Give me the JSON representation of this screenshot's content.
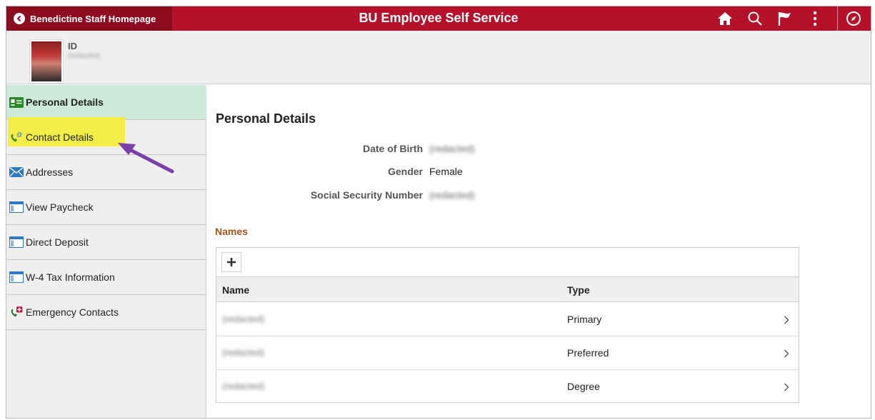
{
  "header": {
    "back_label": "Benedictine Staff Homepage",
    "title": "BU Employee Self Service",
    "icons": [
      "home-icon",
      "search-icon",
      "flag-icon",
      "more-options-icon",
      "navbar-compass-icon"
    ],
    "colors": {
      "header_bg": "#b5112a",
      "back_bg": "#8e0c20"
    }
  },
  "profile": {
    "id_label": "ID",
    "id_value": "(redacted)"
  },
  "sidebar": {
    "items": [
      {
        "label": "Personal Details",
        "icon": "id-card-icon",
        "active": true
      },
      {
        "label": "Contact Details",
        "icon": "phone-at-icon",
        "highlighted": true
      },
      {
        "label": "Addresses",
        "icon": "envelope-icon"
      },
      {
        "label": "View Paycheck",
        "icon": "document-window-icon"
      },
      {
        "label": "Direct Deposit",
        "icon": "document-window-icon"
      },
      {
        "label": "W-4 Tax Information",
        "icon": "document-window-icon"
      },
      {
        "label": "Emergency Contacts",
        "icon": "phone-cross-icon"
      }
    ],
    "colors": {
      "active_bg": "#cde9d9",
      "highlight": "#f2ee45",
      "arrow": "#7a3fa8"
    }
  },
  "main": {
    "title": "Personal Details",
    "fields": [
      {
        "label": "Date of Birth",
        "value": "(redacted)",
        "blurred": true
      },
      {
        "label": "Gender",
        "value": "Female",
        "blurred": false
      },
      {
        "label": "Social Security Number",
        "value": "(redacted)",
        "blurred": true
      }
    ],
    "names": {
      "title": "Names",
      "add_icon": "plus-icon",
      "columns": [
        "Name",
        "Type"
      ],
      "rows": [
        {
          "name": "(redacted)",
          "type": "Primary"
        },
        {
          "name": "(redacted)",
          "type": "Preferred"
        },
        {
          "name": "(redacted)",
          "type": "Degree"
        }
      ],
      "colors": {
        "title": "#a3571e"
      }
    }
  }
}
